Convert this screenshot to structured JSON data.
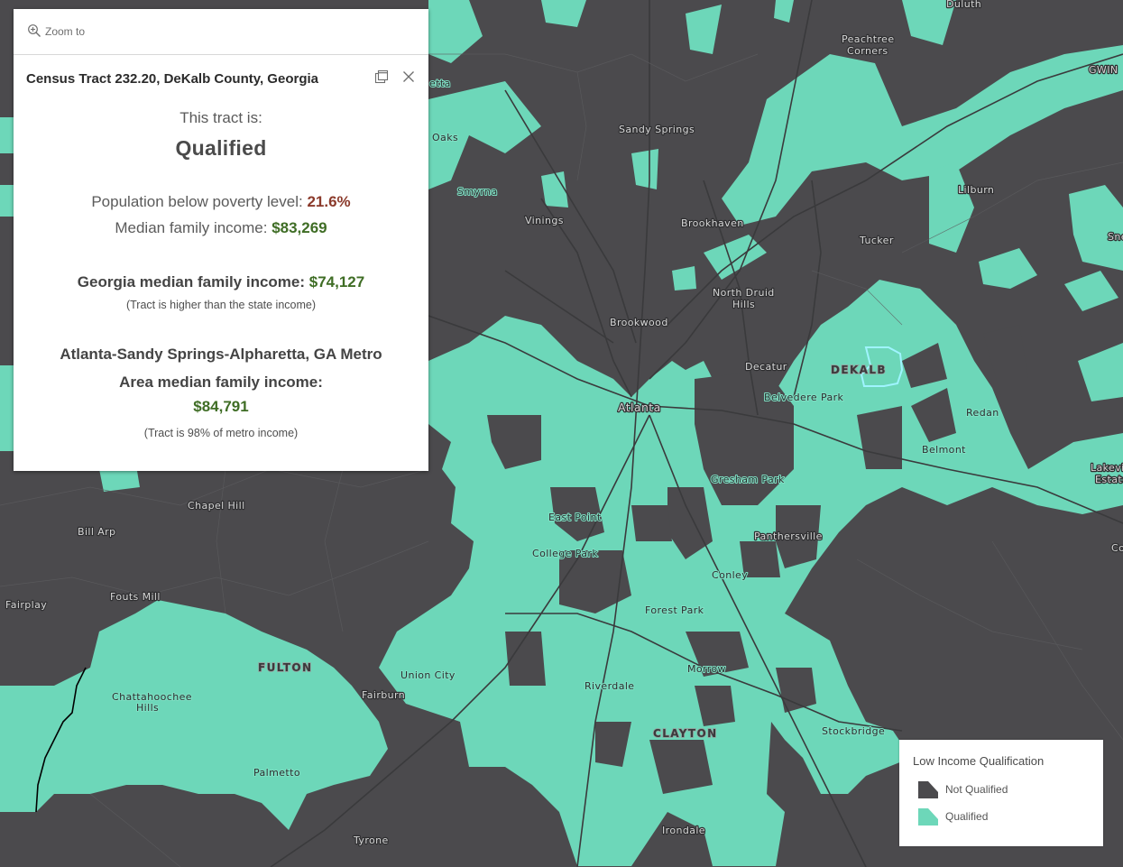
{
  "popup": {
    "zoom_label": "Zoom to",
    "title": "Census Tract 232.20, DeKalb County, Georgia",
    "lead": "This tract is:",
    "status": "Qualified",
    "poverty_label": "Population below poverty level: ",
    "poverty_value": "21.6%",
    "income_label": "Median family income: ",
    "income_value": "$83,269",
    "state_label": "Georgia median family income: ",
    "state_value": "$74,127",
    "state_note": "(Tract is higher than the state income)",
    "metro_line1": "Atlanta-Sandy Springs-Alpharetta, GA Metro",
    "metro_line2": "Area median family income:",
    "metro_value": "$84,791",
    "metro_note": "(Tract is 98% of metro income)"
  },
  "legend": {
    "title": "Low Income Qualification",
    "items": [
      {
        "label": "Not Qualified",
        "color": "#4b4a4d"
      },
      {
        "label": "Qualified",
        "color": "#6dd7b9"
      }
    ]
  },
  "map": {
    "colors": {
      "not_qualified": "#4b4a4d",
      "qualified": "#6dd7b9",
      "roads": "#38383a",
      "selected_outline": "#9ff4ff"
    },
    "places": {
      "duluth": "Duluth",
      "peachtree_1": "Peachtree",
      "peachtree_2": "Corners",
      "gwin": "GWIN",
      "etta": "etta",
      "oaks": "Oaks",
      "sandy_springs": "Sandy Springs",
      "smyrna": "Smyrna",
      "vinings": "Vinings",
      "brookhaven": "Brookhaven",
      "lilburn": "Lilburn",
      "tucker": "Tucker",
      "sne": "Sne",
      "north_druid_1": "North Druid",
      "north_druid_2": "Hills",
      "brookwood": "Brookwood",
      "decatur": "Decatur",
      "dekalb": "DEKALB",
      "belvedere": "Belvedere Park",
      "redan": "Redan",
      "atlanta": "Atlanta",
      "belmont": "Belmont",
      "lakeview_1": "Lakevi",
      "lakeview_2": "Estate",
      "gresham": "Gresham Park",
      "chapel_hill": "Chapel Hill",
      "east_point": "East Point",
      "bill_arp": "Bill Arp",
      "panthersville": "Panthersville",
      "college_park": "College Park",
      "co": "Co",
      "conley": "Conley",
      "fouts_mill": "Fouts Mill",
      "fairplay": "Fairplay",
      "forest_park": "Forest Park",
      "fulton": "FULTON",
      "union_city": "Union City",
      "morrow": "Morrow",
      "chatt_1": "Chattahoochee",
      "chatt_2": "Hills",
      "riverdale": "Riverdale",
      "fairburn": "Fairburn",
      "clayton": "CLAYTON",
      "stockbridge": "Stockbridge",
      "palmetto": "Palmetto",
      "irondale": "Irondale",
      "tyrone": "Tyrone"
    }
  }
}
